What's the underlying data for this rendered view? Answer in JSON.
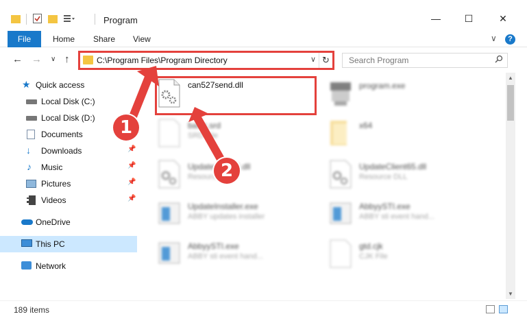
{
  "window": {
    "title": "Program",
    "minimize": "—",
    "maximize": "☐",
    "close": "✕"
  },
  "ribbon": {
    "tabs": [
      "File",
      "Home",
      "Share",
      "View"
    ],
    "collapse": "∨",
    "help": "?"
  },
  "nav": {
    "back": "←",
    "forward": "→",
    "recent": "∨",
    "up": "↑",
    "address": "C:\\Program Files\\Program Directory",
    "address_dropdown": "∨",
    "refresh": "↻",
    "search_placeholder": "Search Program"
  },
  "sidebar": {
    "items": [
      {
        "label": "Quick access",
        "icon": "star-icon"
      },
      {
        "label": "Local Disk (C:)",
        "icon": "drive-icon"
      },
      {
        "label": "Local Disk (D:)",
        "icon": "drive-icon"
      },
      {
        "label": "Documents",
        "icon": "documents-icon"
      },
      {
        "label": "Downloads",
        "icon": "download-icon",
        "pinned": true
      },
      {
        "label": "Music",
        "icon": "music-icon",
        "pinned": true
      },
      {
        "label": "Pictures",
        "icon": "pictures-icon",
        "pinned": true
      },
      {
        "label": "Videos",
        "icon": "videos-icon",
        "pinned": true
      },
      {
        "label": "OneDrive",
        "icon": "cloud-icon"
      },
      {
        "label": "This PC",
        "icon": "pc-icon",
        "selected": true
      },
      {
        "label": "Network",
        "icon": "network-icon"
      }
    ]
  },
  "files": [
    {
      "name": "can527send.dll",
      "desc": "",
      "icon": "dll-gear-icon",
      "highlighted": true
    },
    {
      "name": "program.exe",
      "desc": "",
      "icon": "exe-icon"
    },
    {
      "name": "basic.srd",
      "desc": "SRD File",
      "icon": "blank-file-icon"
    },
    {
      "name": "x64",
      "desc": "",
      "icon": "folder-icon"
    },
    {
      "name": "UpdateClient5.dll",
      "desc": "Resource DLL",
      "icon": "dll-gear-icon"
    },
    {
      "name": "UpdateClient65.dll",
      "desc": "Resource DLL",
      "icon": "dll-gear-icon"
    },
    {
      "name": "UpdateInstaller.exe",
      "desc": "ABBY updates installer",
      "icon": "installer-icon"
    },
    {
      "name": "AbbyySTI.exe",
      "desc": "ABBY sti event hand...",
      "icon": "installer-icon"
    },
    {
      "name": "AbbyySTI.exe",
      "desc": "ABBY sti event hand...",
      "icon": "installer-icon"
    },
    {
      "name": "gtd.cjk",
      "desc": "CJK File",
      "icon": "blank-file-icon"
    }
  ],
  "status": {
    "count": "189 items"
  },
  "markers": [
    "1",
    "2"
  ],
  "colors": {
    "accent": "#1979ca",
    "highlight": "#e4413c",
    "selection": "#cce8ff"
  }
}
